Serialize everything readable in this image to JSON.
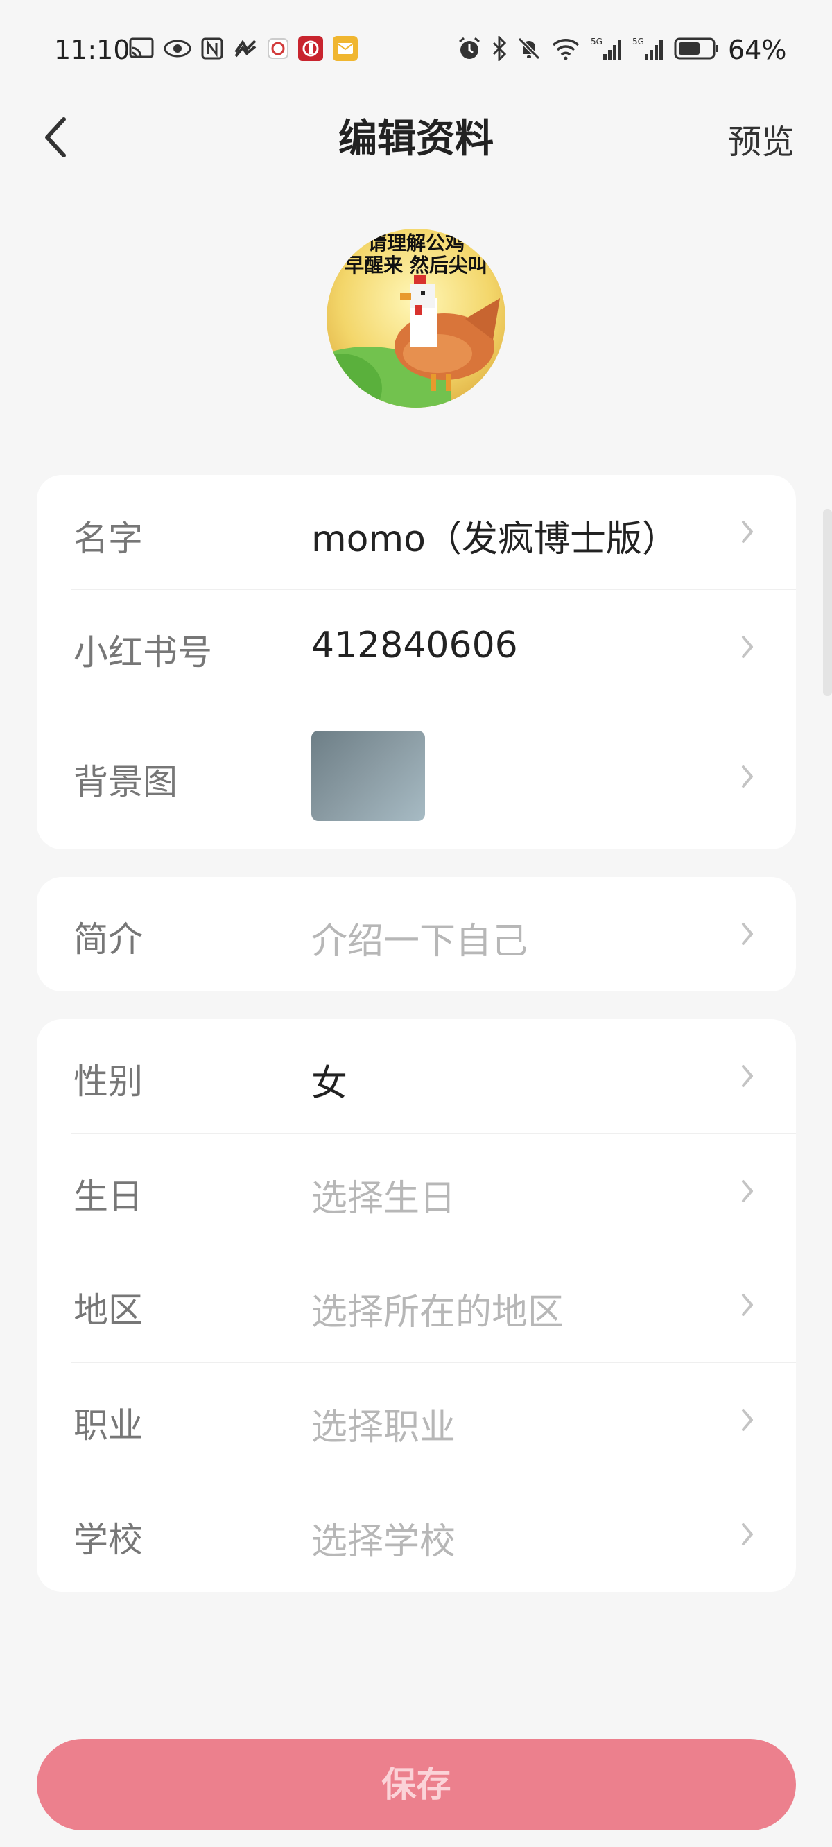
{
  "status": {
    "time": "11:10",
    "battery": "64%"
  },
  "nav": {
    "title": "编辑资料",
    "preview": "预览"
  },
  "avatar": {
    "caption_line1": "请理解公鸡",
    "caption_line2": "早醒来 然后尖叫"
  },
  "profile": {
    "name_label": "名字",
    "name_value": "momo（发疯博士版）",
    "id_label": "小红书号",
    "id_value": "412840606",
    "bg_label": "背景图"
  },
  "intro": {
    "label": "简介",
    "placeholder": "介绍一下自己"
  },
  "details": {
    "gender_label": "性别",
    "gender_value": "女",
    "birthday_label": "生日",
    "birthday_placeholder": "选择生日",
    "region_label": "地区",
    "region_placeholder": "选择所在的地区",
    "job_label": "职业",
    "job_placeholder": "选择职业",
    "school_label": "学校",
    "school_placeholder": "选择学校"
  },
  "actions": {
    "save": "保存"
  },
  "colors": {
    "accent": "#ec808d",
    "background": "#f6f6f6",
    "card": "#ffffff"
  },
  "icons": {
    "back": "chevron-left-icon",
    "row_arrow": "chevron-right-icon"
  }
}
